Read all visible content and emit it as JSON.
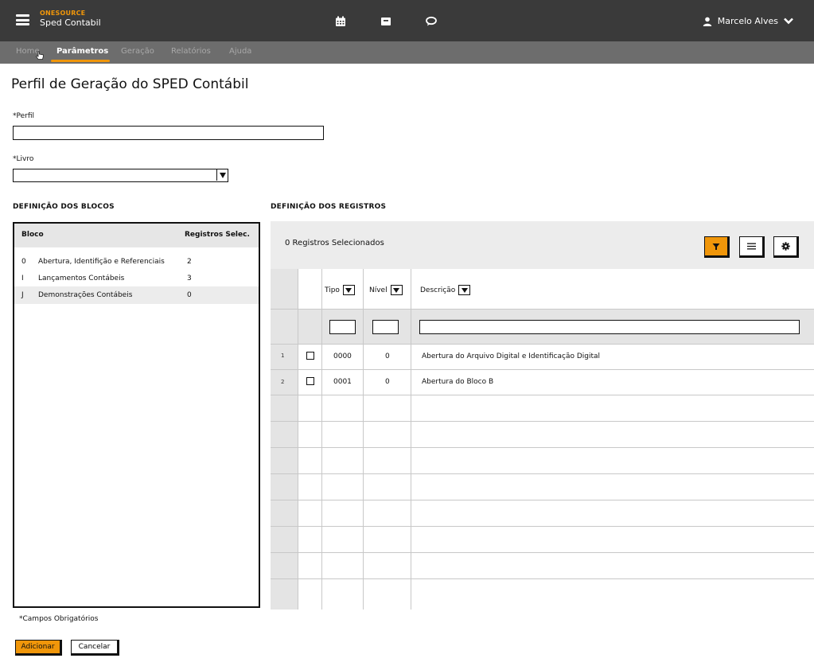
{
  "header": {
    "brand_sub": "ONESOURCE",
    "app_name": "Sped Contabil",
    "user_name": "Marcelo Alves"
  },
  "nav": {
    "items": [
      {
        "label": "Home"
      },
      {
        "label": "Parâmetros"
      },
      {
        "label": "Geração"
      },
      {
        "label": "Relatórios"
      },
      {
        "label": "Ajuda"
      }
    ],
    "active": "Parâmetros"
  },
  "page": {
    "title": "Perfil de Geração do SPED Contábil"
  },
  "form": {
    "perfil_label": "*Perfil",
    "perfil_value": "",
    "livro_label": "*Livro",
    "livro_value": ""
  },
  "blocos": {
    "section_title": "DEFINIÇÃO DOS BLOCOS",
    "col_bloco": "Bloco",
    "col_registros": "Registros Selec.",
    "rows": [
      {
        "code": "0",
        "name": "Abertura, Identifição e Referenciais",
        "count": "2"
      },
      {
        "code": "I",
        "name": "Lançamentos Contábeis",
        "count": "3"
      },
      {
        "code": "J",
        "name": "Demonstrações Contábeis",
        "count": "0"
      }
    ]
  },
  "registros": {
    "section_title": "DEFINIÇÃO DOS REGISTROS",
    "selected_text": "0 Registros Selecionados",
    "col_tipo": "Tipo",
    "col_nivel": "Nível",
    "col_descricao": "Descrição",
    "rows": [
      {
        "index": "1",
        "tipo": "0000",
        "nivel": "0",
        "descricao": "Abertura do Arquivo Digital e Identificação Digital"
      },
      {
        "index": "2",
        "tipo": "0001",
        "nivel": "0",
        "descricao": "Abertura do Bloco B"
      }
    ]
  },
  "footer": {
    "required_note": "*Campos Obrigatórios",
    "add_label": "Adicionar",
    "cancel_label": "Cancelar"
  },
  "colors": {
    "accent": "#f0960a",
    "topbar": "#3a3a3a",
    "navbar": "#6d6d6d"
  },
  "icons": {
    "menu": "hamburger-icon",
    "calendar": "calendar-icon",
    "inbox": "inbox-icon",
    "chat": "chat-icon",
    "user": "user-icon",
    "chevron": "chevron-down-icon",
    "filter": "filter-icon",
    "list": "list-icon",
    "settings": "gear-icon"
  }
}
